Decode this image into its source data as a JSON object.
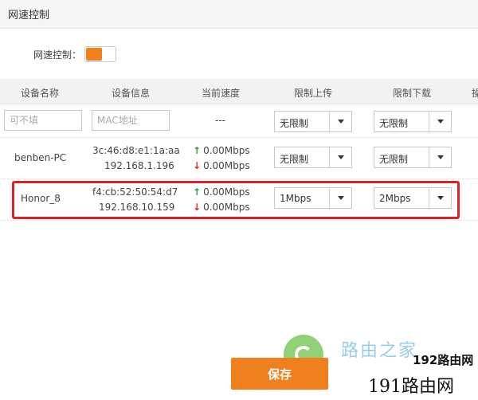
{
  "page": {
    "title": "网速控制"
  },
  "control": {
    "label": "网速控制：",
    "enabled": true,
    "accent": "#f07f1e"
  },
  "table": {
    "headers": {
      "name": "设备名称",
      "info": "设备信息",
      "speed": "当前速度",
      "upload": "限制上传",
      "download": "限制下载",
      "extra": "操"
    },
    "new_row": {
      "name_placeholder": "可不填",
      "mac_placeholder": "MAC地址",
      "speed": "---",
      "upload": "无限制",
      "download": "无限制"
    },
    "rows": [
      {
        "name": "benben-PC",
        "mac": "3c:46:d8:e1:1a:aa",
        "ip": "192.168.1.196",
        "up": "0.00Mbps",
        "down": "0.00Mbps",
        "upload": "无限制",
        "download": "无限制"
      },
      {
        "name": "Honor_8",
        "mac": "f4:cb:52:50:54:d7",
        "ip": "192.168.10.159",
        "up": "0.00Mbps",
        "down": "0.00Mbps",
        "upload": "1Mbps",
        "download": "2Mbps"
      }
    ]
  },
  "icons": {
    "up": "↑",
    "down": "↓",
    "select": "caret-down-icon"
  },
  "actions": {
    "save": "保存"
  },
  "watermark": {
    "line1": "路由之家",
    "line2": "192路由网",
    "line3": "191路由网"
  },
  "colors": {
    "up": "#2a9d3a",
    "down": "#e0281c",
    "highlight": "#e01f26"
  }
}
